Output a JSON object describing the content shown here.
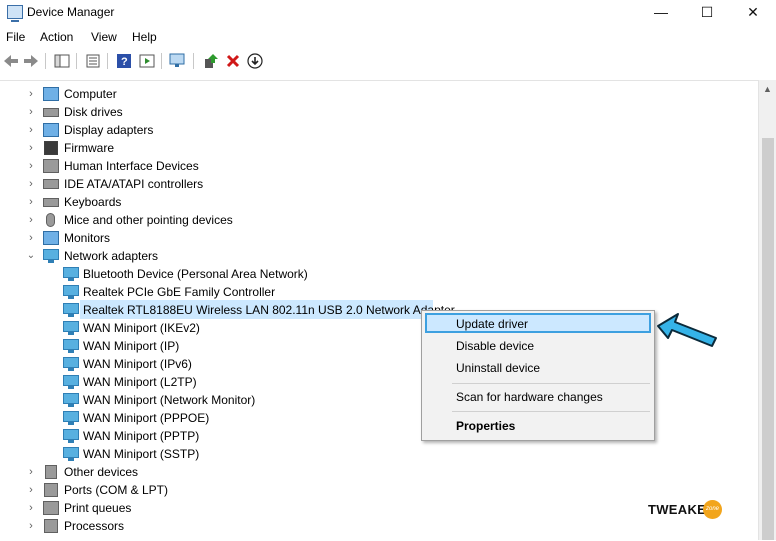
{
  "window": {
    "title": "Device Manager",
    "controls": {
      "minimize": "—",
      "maximize": "☐",
      "close": "✕"
    }
  },
  "menu": [
    "File",
    "Action",
    "View",
    "Help"
  ],
  "toolbar": {
    "icons": [
      "back-icon",
      "forward-icon",
      "console-tree-icon",
      "properties-icon",
      "help-icon",
      "action-pane-icon",
      "scan-hardware-icon",
      "update-driver-icon",
      "uninstall-icon",
      "download-icon"
    ]
  },
  "tree": {
    "categories_top": [
      {
        "label": "Computer",
        "icon": "computer-icon"
      },
      {
        "label": "Disk drives",
        "icon": "disk-drive-icon"
      },
      {
        "label": "Display adapters",
        "icon": "display-adapter-icon"
      },
      {
        "label": "Firmware",
        "icon": "firmware-icon"
      },
      {
        "label": "Human Interface Devices",
        "icon": "hid-icon"
      },
      {
        "label": "IDE ATA/ATAPI controllers",
        "icon": "ide-controller-icon"
      },
      {
        "label": "Keyboards",
        "icon": "keyboard-icon"
      },
      {
        "label": "Mice and other pointing devices",
        "icon": "mouse-icon"
      },
      {
        "label": "Monitors",
        "icon": "monitor-icon"
      }
    ],
    "expanded_category": {
      "label": "Network adapters",
      "icon": "network-adapter-icon"
    },
    "network_adapters": [
      "Bluetooth Device (Personal Area Network)",
      "Realtek PCIe GbE Family Controller",
      "Realtek RTL8188EU Wireless LAN 802.11n USB 2.0 Network Adapter",
      "WAN Miniport (IKEv2)",
      "WAN Miniport (IP)",
      "WAN Miniport (IPv6)",
      "WAN Miniport (L2TP)",
      "WAN Miniport (Network Monitor)",
      "WAN Miniport (PPPOE)",
      "WAN Miniport (PPTP)",
      "WAN Miniport (SSTP)"
    ],
    "selected_index": 2,
    "categories_bottom": [
      {
        "label": "Other devices",
        "icon": "other-devices-icon"
      },
      {
        "label": "Ports (COM & LPT)",
        "icon": "ports-icon"
      },
      {
        "label": "Print queues",
        "icon": "printer-icon"
      },
      {
        "label": "Processors",
        "icon": "processor-icon"
      }
    ]
  },
  "context_menu": {
    "items": [
      {
        "label": "Update driver",
        "highlighted": true
      },
      {
        "label": "Disable device"
      },
      {
        "label": "Uninstall device"
      },
      {
        "label": "Scan for hardware changes"
      },
      {
        "label": "Properties",
        "bold": true
      }
    ]
  },
  "brand": {
    "text": "TWEAKER",
    "badge": "zone"
  },
  "colors": {
    "selection": "#cce8ff",
    "highlight_border": "#3da0e0",
    "pointer_fill": "#35b3e8",
    "brand_badge": "#f2a51c"
  }
}
